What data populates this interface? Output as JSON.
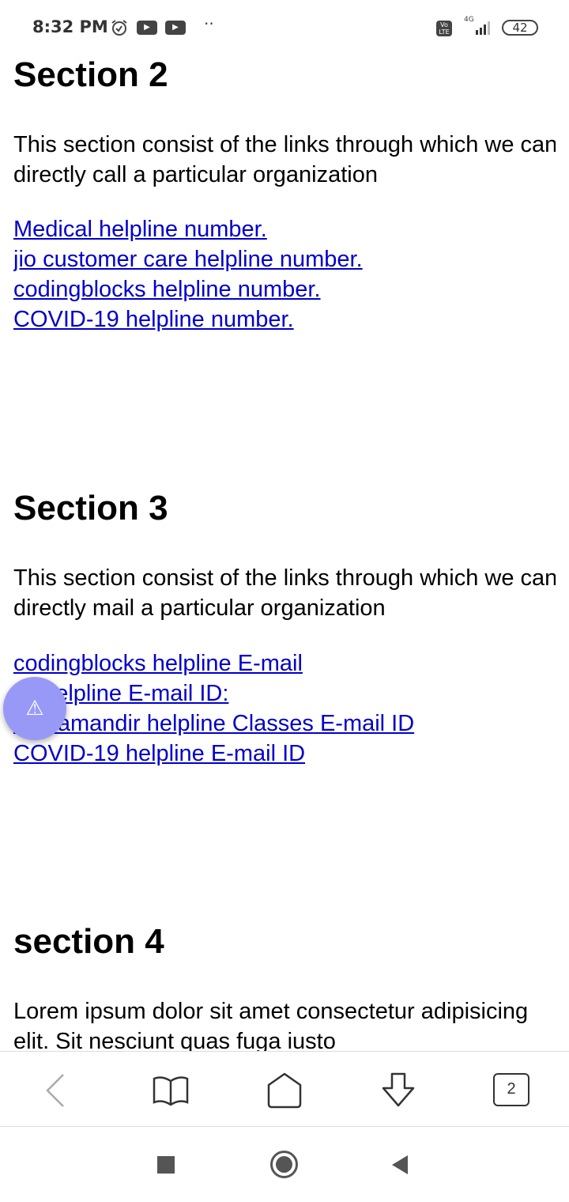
{
  "status_bar": {
    "time": "8:32 PM",
    "battery": "42",
    "network": "4G",
    "volte": "Vo LTE"
  },
  "sections": [
    {
      "title": "Section 2",
      "description": "This section consist of the links through which we can directly call a particular organization",
      "links": [
        "Medical helpline number.",
        "jio customer care helpline number.",
        "codingblocks helpline number.",
        "COVID-19 helpline number. "
      ]
    },
    {
      "title": "Section 3",
      "description": "This section consist of the links through which we can directly mail a particular organization",
      "links": [
        "codingblocks helpline E-mail",
        "jio helpline E-mail ID:",
        "Vidyamandir helpline Classes E-mail ID",
        "COVID-19 helpline E-mail ID"
      ]
    },
    {
      "title": "section 4",
      "description": "Lorem ipsum dolor sit amet consectetur adipisicing elit. Sit nesciunt quas fuga iusto"
    }
  ],
  "fab": {
    "icon": "warning-icon"
  },
  "toolbar": {
    "tabs_count": "2"
  }
}
